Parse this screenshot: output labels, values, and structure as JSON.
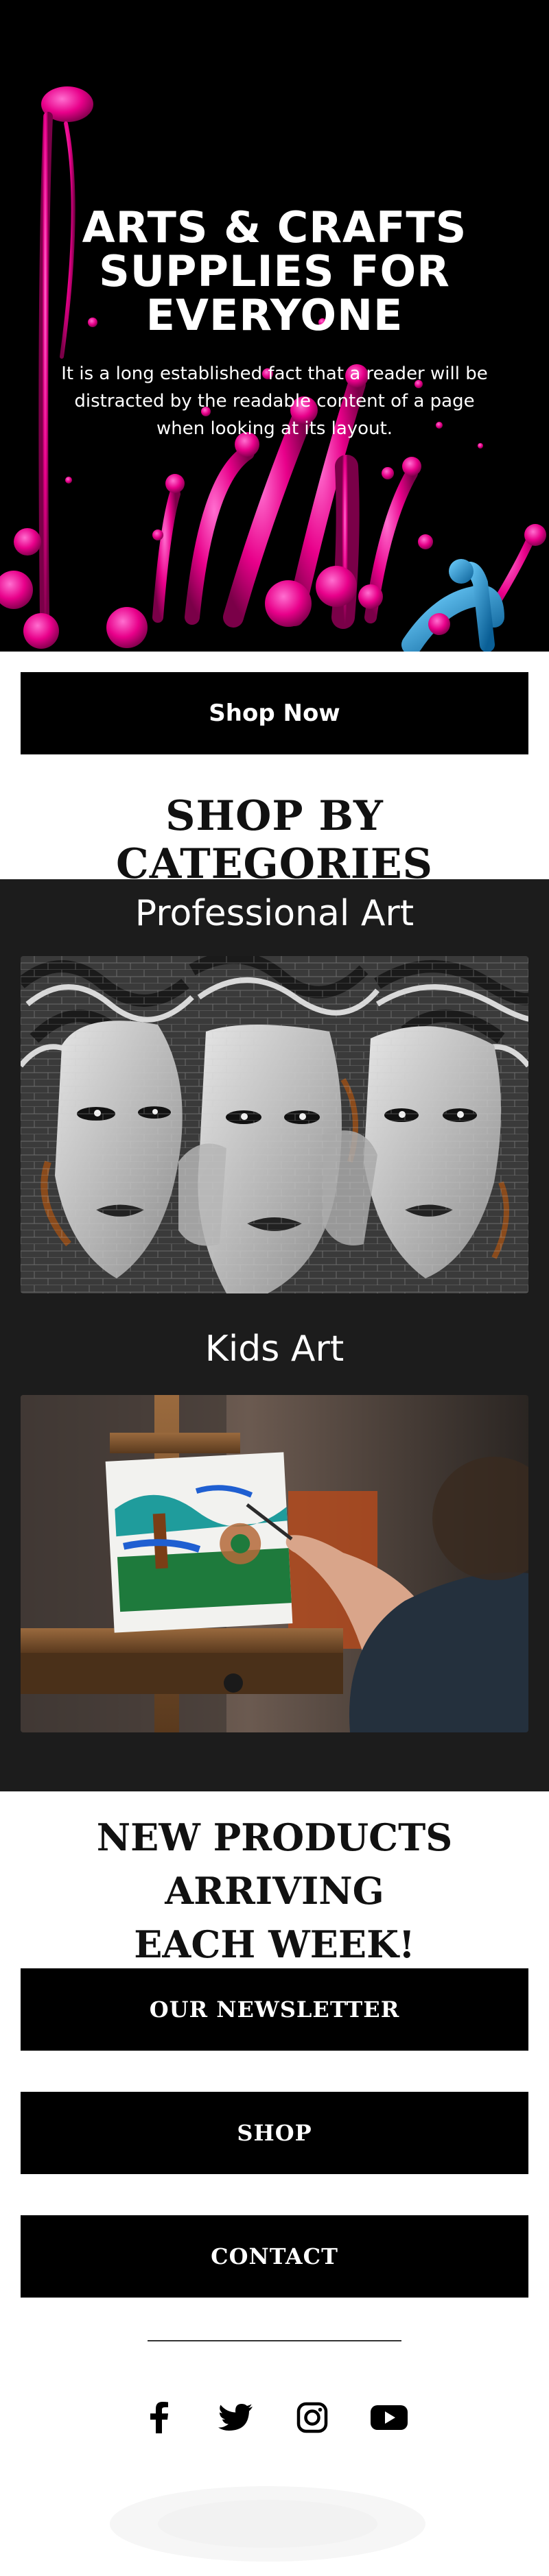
{
  "hero": {
    "title_line1": "ARTS & CRAFTS",
    "title_line2": "SUPPLIES FOR",
    "title_line3": "EVERYONE",
    "description": "It is a long established fact that a reader will be distracted by the readable content of a page when looking at its layout."
  },
  "cta": {
    "shop_now_label": "Shop Now"
  },
  "categories": {
    "heading": "SHOP BY CATEGORIES",
    "items": [
      {
        "label": "Professional Art",
        "image": "graffiti-faces-mural"
      },
      {
        "label": "Kids Art",
        "image": "child-painting-on-easel"
      }
    ]
  },
  "announcement": {
    "line1": "NEW PRODUCTS ARRIVING",
    "line2": "EACH WEEK!"
  },
  "links": {
    "newsletter_label": "OUR NEWSLETTER",
    "shop_label": "SHOP",
    "contact_label": "CONTACT"
  },
  "social": {
    "icons": [
      "facebook-icon",
      "twitter-icon",
      "instagram-icon",
      "youtube-icon"
    ]
  },
  "colors": {
    "accent_pink": "#ff1aa8",
    "accent_blue": "#1f9bd7",
    "button_bg": "#000000",
    "categories_bg": "#1c1c1c"
  }
}
